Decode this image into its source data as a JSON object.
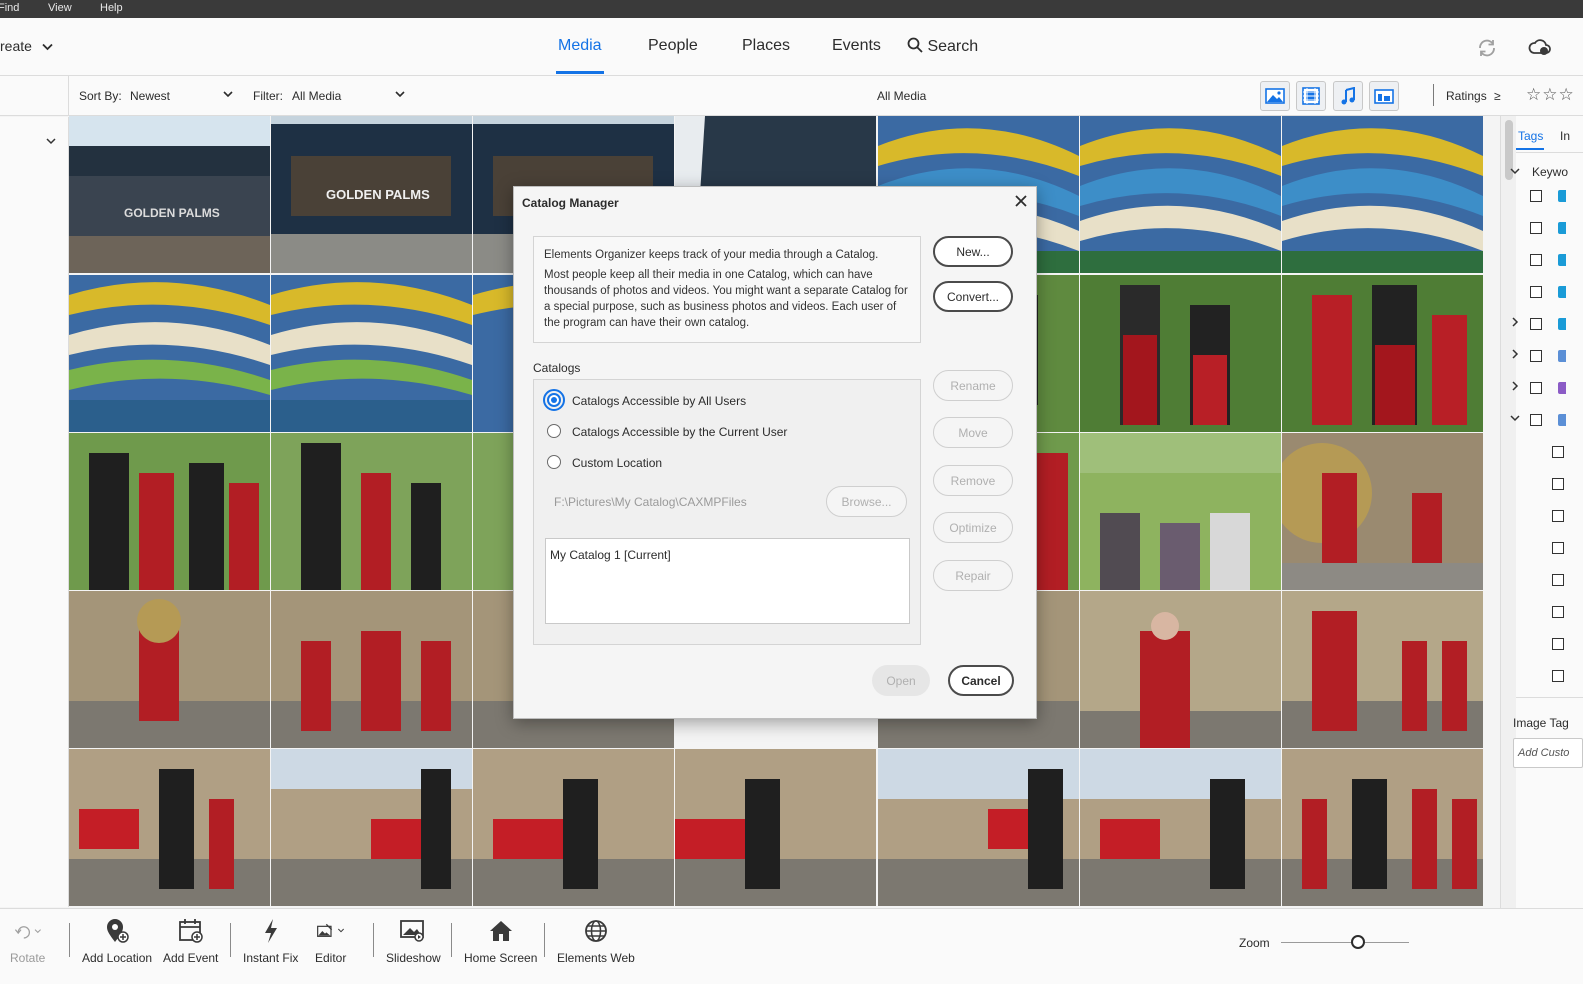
{
  "menu": {
    "items": [
      "Find",
      "View",
      "Help"
    ]
  },
  "topbar": {
    "create_label": "reate",
    "tabs": [
      "Media",
      "People",
      "Places",
      "Events"
    ],
    "active_tab": "Media",
    "search_label": "Search"
  },
  "filterbar": {
    "sort_by_label": "Sort By:",
    "sort_by_value": "Newest",
    "filter_label": "Filter:",
    "filter_value": "All Media",
    "center_label": "All Media",
    "ratings_label": "Ratings",
    "ratings_operator": "≥",
    "ratings_stars": "☆☆☆",
    "media_type_buttons": [
      "photos-icon",
      "videos-icon",
      "audio-icon",
      "projects-icon"
    ]
  },
  "right_panel": {
    "tabs": [
      "Tags",
      "In"
    ],
    "keywords_label": "Keywo",
    "image_tags_label": "Image Tag",
    "add_custom_placeholder": "Add Custo"
  },
  "bottombar": {
    "tools": [
      {
        "label": "Rotate",
        "icon": "rotate-icon",
        "enabled": false
      },
      {
        "label": "Add Location",
        "icon": "add-location-icon",
        "enabled": true
      },
      {
        "label": "Add Event",
        "icon": "add-event-icon",
        "enabled": true
      },
      {
        "label": "Instant Fix",
        "icon": "instant-fix-icon",
        "enabled": true
      },
      {
        "label": "Editor",
        "icon": "editor-icon",
        "enabled": true
      },
      {
        "label": "Slideshow",
        "icon": "slideshow-icon",
        "enabled": true
      },
      {
        "label": "Home Screen",
        "icon": "home-icon",
        "enabled": true
      },
      {
        "label": "Elements Web",
        "icon": "globe-icon",
        "enabled": true
      }
    ],
    "zoom_label": "Zoom",
    "zoom_level": 0.55
  },
  "thumbnail_text": {
    "sign_1": "GOLDEN PALMS",
    "sign_2": "GOLDEN PALMS"
  },
  "dialog": {
    "title": "Catalog Manager",
    "info_line_1": "Elements Organizer keeps track of your media through a Catalog.",
    "info_line_2": "Most people keep all their media in one Catalog, which can have thousands of photos and videos. You might want a separate Catalog for a special purpose, such as business photos and videos. Each user of the program can have their own catalog.",
    "buttons": {
      "new": "New...",
      "convert": "Convert...",
      "rename": "Rename",
      "move": "Move",
      "remove": "Remove",
      "optimize": "Optimize",
      "repair": "Repair",
      "browse": "Browse...",
      "open": "Open",
      "cancel": "Cancel"
    },
    "catalogs_label": "Catalogs",
    "options": [
      {
        "label": "Catalogs Accessible by All Users",
        "selected": true
      },
      {
        "label": "Catalogs Accessible by the Current User",
        "selected": false
      },
      {
        "label": "Custom Location",
        "selected": false
      }
    ],
    "custom_path": "F:\\Pictures\\My Catalog\\CAXMPFiles",
    "catalog_list": [
      "My Catalog 1 [Current]"
    ]
  },
  "colors": {
    "accent": "#1473e6",
    "menubar_bg": "#3a3a3a"
  }
}
